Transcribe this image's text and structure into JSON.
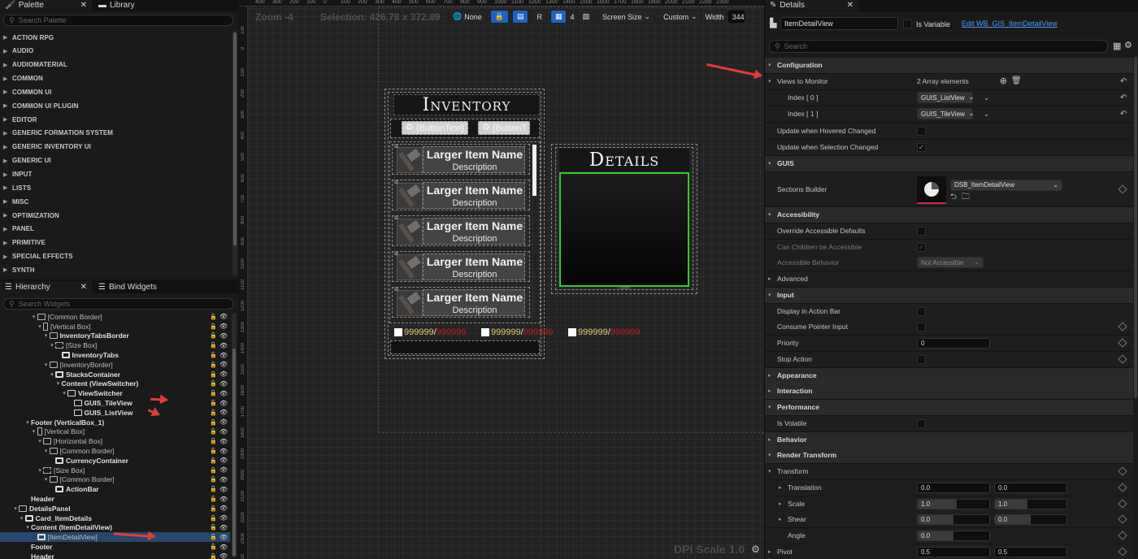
{
  "palette": {
    "tab_label": "Palette",
    "library_tab_label": "Library",
    "search_placeholder": "Search Palette",
    "categories": [
      "ACTION RPG",
      "AUDIO",
      "AUDIOMATERIAL",
      "COMMON",
      "COMMON UI",
      "COMMON UI PLUGIN",
      "EDITOR",
      "GENERIC FORMATION SYSTEM",
      "GENERIC INVENTORY UI",
      "GENERIC UI",
      "INPUT",
      "LISTS",
      "MISC",
      "OPTIMIZATION",
      "PANEL",
      "PRIMITIVE",
      "SPECIAL EFFECTS",
      "SYNTH"
    ]
  },
  "hierarchy": {
    "tab_label": "Hierarchy",
    "bind_tab_label": "Bind Widgets",
    "search_placeholder": "Search Widgets",
    "rows": [
      {
        "label": "[Common Border]",
        "depth": 5,
        "bold": false,
        "expander": "▾",
        "icon": "border"
      },
      {
        "label": "[Vertical Box]",
        "depth": 6,
        "bold": false,
        "expander": "▾",
        "icon": "vbox"
      },
      {
        "label": "InventoryTabsBorder",
        "depth": 7,
        "bold": true,
        "expander": "▾",
        "icon": "border"
      },
      {
        "label": "[Size Box]",
        "depth": 8,
        "bold": false,
        "expander": "▾",
        "icon": "size"
      },
      {
        "label": "InventoryTabs",
        "depth": 9,
        "bold": true,
        "expander": "",
        "icon": "widget"
      },
      {
        "label": "[InventoryBorder]",
        "depth": 7,
        "bold": false,
        "expander": "▾",
        "icon": "border"
      },
      {
        "label": "StacksContainer",
        "depth": 8,
        "bold": true,
        "expander": "▾",
        "icon": "widget"
      },
      {
        "label": "Content (ViewSwitcher)",
        "depth": 9,
        "bold": true,
        "expander": "▾",
        "icon": "none"
      },
      {
        "label": "ViewSwitcher",
        "depth": 10,
        "bold": true,
        "expander": "▾",
        "icon": "file"
      },
      {
        "label": "GUIS_TileView",
        "depth": 11,
        "bold": true,
        "expander": "",
        "icon": "grid"
      },
      {
        "label": "GUIS_ListView",
        "depth": 11,
        "bold": true,
        "expander": "",
        "icon": "grid"
      },
      {
        "label": "Footer (VerticalBox_1)",
        "depth": 4,
        "bold": true,
        "expander": "▾",
        "icon": "none"
      },
      {
        "label": "[Vertical Box]",
        "depth": 5,
        "bold": false,
        "expander": "▾",
        "icon": "vbox"
      },
      {
        "label": "[Horizontal Box]",
        "depth": 6,
        "bold": false,
        "expander": "▾",
        "icon": "hbox"
      },
      {
        "label": "[Common Border]",
        "depth": 7,
        "bold": false,
        "expander": "▾",
        "icon": "border"
      },
      {
        "label": "CurrencyContainer",
        "depth": 8,
        "bold": true,
        "expander": "",
        "icon": "widget"
      },
      {
        "label": "[Size Box]",
        "depth": 6,
        "bold": false,
        "expander": "▾",
        "icon": "size"
      },
      {
        "label": "[Common Border]",
        "depth": 7,
        "bold": false,
        "expander": "▾",
        "icon": "border"
      },
      {
        "label": "ActionBar",
        "depth": 8,
        "bold": true,
        "expander": "",
        "icon": "widget"
      },
      {
        "label": "Header",
        "depth": 4,
        "bold": true,
        "expander": "",
        "icon": "none"
      },
      {
        "label": "DetailsPanel",
        "depth": 2,
        "bold": true,
        "expander": "▾",
        "icon": "border"
      },
      {
        "label": "Card_ItemDetails",
        "depth": 3,
        "bold": true,
        "expander": "▾",
        "icon": "widget"
      },
      {
        "label": "Content (ItemDetailView)",
        "depth": 4,
        "bold": true,
        "expander": "▾",
        "icon": "none"
      },
      {
        "label": "[ItemDetailView]",
        "depth": 5,
        "bold": false,
        "expander": "",
        "icon": "widget",
        "selected": true
      },
      {
        "label": "Footer",
        "depth": 4,
        "bold": true,
        "expander": "",
        "icon": "none"
      },
      {
        "label": "Header",
        "depth": 4,
        "bold": true,
        "expander": "",
        "icon": "none"
      }
    ]
  },
  "canvas": {
    "zoom_label": "Zoom -4",
    "selection_label": "Selection: 426.78 x 372.89",
    "ruler_marks": [
      "400",
      "300",
      "200",
      "100",
      "0",
      "100",
      "200",
      "300",
      "400",
      "500",
      "600",
      "700",
      "800",
      "900",
      "1000",
      "1100",
      "1200",
      "1300",
      "1400",
      "1500",
      "1600",
      "1700",
      "1800",
      "1900",
      "2000",
      "2100",
      "2200",
      "2300"
    ],
    "ruler_left_marks": [
      "100",
      "0",
      "100",
      "200",
      "300",
      "400",
      "500",
      "600",
      "700",
      "800",
      "900",
      "1000",
      "1100",
      "1200",
      "1300",
      "1400",
      "1500",
      "1600",
      "1700",
      "1800",
      "1900",
      "2000",
      "2100",
      "2200",
      "2300",
      "2400"
    ],
    "toolbar": {
      "none_label": "None",
      "r_label": "R",
      "grid_count": "4",
      "screen_size_label": "Screen Size",
      "custom_label": "Custom",
      "width_label": "Width",
      "width_value": "344"
    },
    "dpi_label": "DPI Scale 1.0",
    "preview": {
      "inventory_title": "Inventory",
      "tab_button_1": "{ButtonText}",
      "tab_button_2": "{ButtonT",
      "items": [
        {
          "name": "Larger Item Name",
          "description": "Description"
        },
        {
          "name": "Larger Item Name",
          "description": "Description"
        },
        {
          "name": "Larger Item Name",
          "description": "Description"
        },
        {
          "name": "Larger Item Name",
          "description": "Description"
        },
        {
          "name": "Larger Item Name",
          "description": "Description"
        }
      ],
      "currency": [
        {
          "value": "999999",
          "separator": "/",
          "max": "999999"
        },
        {
          "value": "999999",
          "separator": "/",
          "max": "999999"
        },
        {
          "value": "999999",
          "separator": "/",
          "max": "999999"
        }
      ],
      "details_title": "Details",
      "footer_label": "Footer"
    }
  },
  "details": {
    "tab_label": "Details",
    "widget_name": "ItemDetailView",
    "is_variable_label": "Is Variable",
    "edit_link": "Edit WB_GIS_ItemDetailView",
    "search_placeholder": "Search",
    "sections": {
      "configuration": "Configuration",
      "views_to_monitor": "Views to Monitor",
      "array_elements": "2 Array elements",
      "index0_label": "Index [ 0 ]",
      "index0_value": "GUIS_ListView",
      "index1_label": "Index [ 1 ]",
      "index1_value": "GUIS_TileView",
      "update_hovered": "Update when Hovered Changed",
      "update_selection": "Update when Selection Changed",
      "guis": "GUIS",
      "sections_builder": "Sections Builder",
      "sections_builder_value": "DSB_ItemDetailView",
      "accessibility": "Accessibility",
      "override_accessible": "Override Accessible Defaults",
      "can_children": "Can Children be Accessible",
      "accessible_behavior": "Accessible Behavior",
      "accessible_behavior_value": "Not Accessible",
      "advanced": "Advanced",
      "input": "Input",
      "display_action_bar": "Display in Action Bar",
      "consume_pointer": "Consume Pointer Input",
      "priority": "Priority",
      "priority_value": "0",
      "stop_action": "Stop Action",
      "appearance": "Appearance",
      "interaction": "Interaction",
      "performance": "Performance",
      "is_volatile": "Is Volatile",
      "behavior": "Behavior",
      "render_transform": "Render Transform",
      "transform": "Transform",
      "translation": "Translation",
      "translation_x": "0.0",
      "translation_y": "0.0",
      "scale": "Scale",
      "scale_x": "1.0",
      "scale_y": "1.0",
      "shear": "Shear",
      "shear_x": "0.0",
      "shear_y": "0.0",
      "angle": "Angle",
      "angle_value": "0.0",
      "pivot": "Pivot",
      "pivot_x": "0.5",
      "pivot_y": "0.5"
    }
  },
  "colors": {
    "accent": "#1e63c4",
    "selection": "#26476c",
    "highlight_green": "#2fcc2f",
    "arrow_red": "#e23b3b"
  }
}
